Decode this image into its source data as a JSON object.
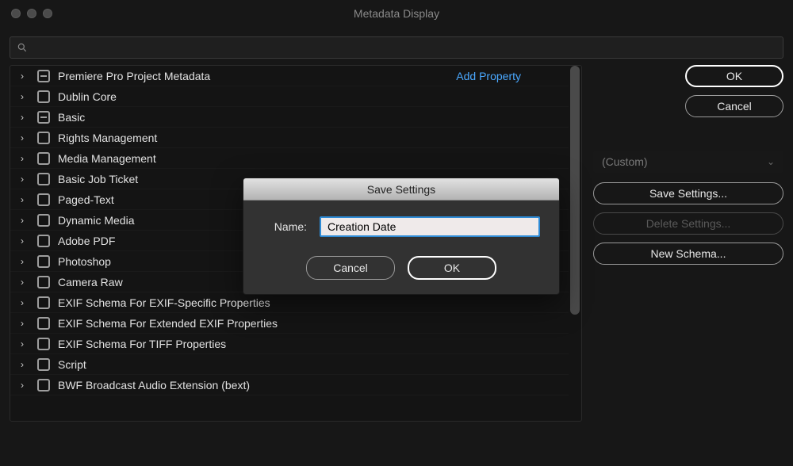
{
  "window": {
    "title": "Metadata Display"
  },
  "search": {
    "value": "",
    "placeholder": ""
  },
  "schemas": [
    {
      "label": "Premiere Pro Project Metadata",
      "state": "indeterminate",
      "add_property": true
    },
    {
      "label": "Dublin Core",
      "state": "unchecked"
    },
    {
      "label": "Basic",
      "state": "indeterminate"
    },
    {
      "label": "Rights Management",
      "state": "unchecked"
    },
    {
      "label": "Media Management",
      "state": "unchecked"
    },
    {
      "label": "Basic Job Ticket",
      "state": "unchecked"
    },
    {
      "label": "Paged-Text",
      "state": "unchecked"
    },
    {
      "label": "Dynamic Media",
      "state": "unchecked"
    },
    {
      "label": "Adobe PDF",
      "state": "unchecked"
    },
    {
      "label": "Photoshop",
      "state": "unchecked"
    },
    {
      "label": "Camera Raw",
      "state": "unchecked"
    },
    {
      "label": "EXIF Schema For EXIF-Specific Properties",
      "state": "unchecked"
    },
    {
      "label": "EXIF Schema For Extended EXIF Properties",
      "state": "unchecked"
    },
    {
      "label": "EXIF Schema For TIFF Properties",
      "state": "unchecked"
    },
    {
      "label": "Script",
      "state": "unchecked"
    },
    {
      "label": "BWF Broadcast Audio Extension (bext)",
      "state": "unchecked"
    }
  ],
  "add_property_label": "Add Property",
  "right": {
    "ok": "OK",
    "cancel": "Cancel",
    "preset": "(Custom)",
    "save_settings": "Save Settings...",
    "delete_settings": "Delete Settings...",
    "new_schema": "New Schema..."
  },
  "modal": {
    "title": "Save Settings",
    "name_label": "Name:",
    "name_value": "Creation Date",
    "cancel": "Cancel",
    "ok": "OK"
  }
}
